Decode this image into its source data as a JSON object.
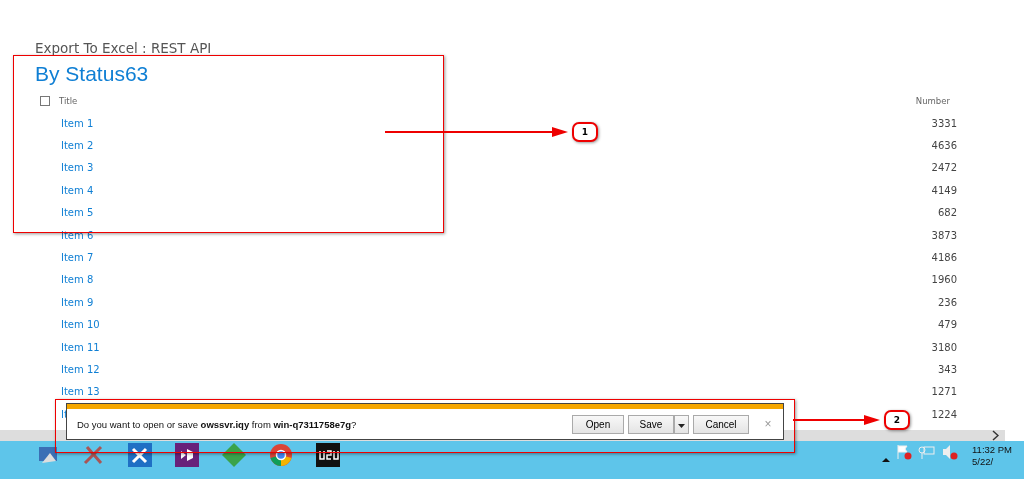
{
  "page": {
    "title": "Export To Excel : REST API",
    "heading": "By Status63"
  },
  "table": {
    "select_all": {
      "checked": false
    },
    "columns": [
      "Title",
      "Number"
    ],
    "rows": [
      {
        "title": "Item 1",
        "number": "3331"
      },
      {
        "title": "Item 2",
        "number": "4636"
      },
      {
        "title": "Item 3",
        "number": "2472"
      },
      {
        "title": "Item 4",
        "number": "4149"
      },
      {
        "title": "Item 5",
        "number": "682"
      },
      {
        "title": "Item 6",
        "number": "3873"
      },
      {
        "title": "Item 7",
        "number": "4186"
      },
      {
        "title": "Item 8",
        "number": "1960"
      },
      {
        "title": "Item 9",
        "number": "236"
      },
      {
        "title": "Item 10",
        "number": "479"
      },
      {
        "title": "Item 11",
        "number": "3180"
      },
      {
        "title": "Item 12",
        "number": "343"
      },
      {
        "title": "Item 13",
        "number": "1271"
      },
      {
        "title": "It",
        "number": "1224"
      }
    ]
  },
  "download_bar": {
    "message": "Do you want to open or save **owssvr.iqy** from **win-q7311758e7g**?",
    "buttons": [
      "Open",
      "Save",
      "Cancel"
    ],
    "close": "×"
  },
  "taskbar": {
    "time": "11:32 PM",
    "date": "5/22/"
  },
  "annotations": [
    {
      "label": "1"
    },
    {
      "label": "2"
    }
  ]
}
